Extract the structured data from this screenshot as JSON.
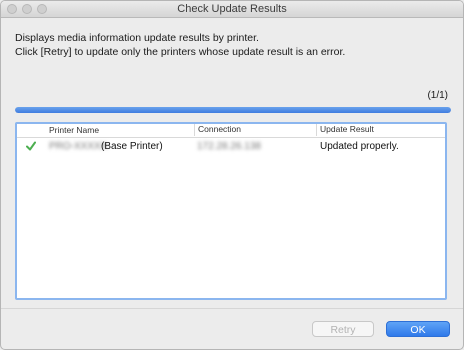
{
  "window": {
    "title": "Check Update Results"
  },
  "description": {
    "line1": "Displays media information update results by printer.",
    "line2": "Click [Retry] to update only the printers whose update result is an error."
  },
  "progress": {
    "counter": "(1/1)",
    "fraction": 1.0,
    "color": "#3f7de0"
  },
  "table": {
    "columns": [
      "Printer Name",
      "Connection",
      "Update Result"
    ],
    "rows": [
      {
        "status_icon": "checkmark-icon",
        "printer_name_redacted": "PRO-XXXXX",
        "printer_name_suffix": "(Base Printer)",
        "connection_redacted": "172.28.26.138",
        "update_result": "Updated properly."
      }
    ]
  },
  "buttons": {
    "retry": "Retry",
    "ok": "OK"
  },
  "colors": {
    "accent": "#2f79ea",
    "success": "#4caf50"
  }
}
